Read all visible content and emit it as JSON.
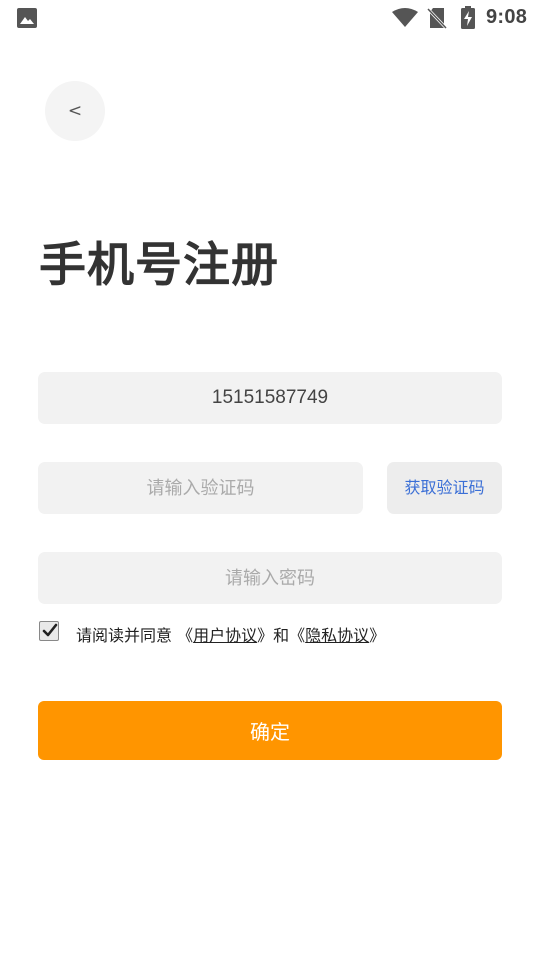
{
  "status_bar": {
    "time": "9:08",
    "icons": [
      "image-icon",
      "wifi-icon",
      "no-sim-icon",
      "battery-charging-icon"
    ]
  },
  "header": {
    "back_label": "<"
  },
  "title": "手机号注册",
  "form": {
    "phone_value": "15151587749",
    "code_placeholder": "请输入验证码",
    "get_code_label": "获取验证码",
    "password_placeholder": "请输入密码"
  },
  "agreement": {
    "checked": true,
    "prefix": "请阅读并同意 ",
    "open_bracket_1": "《",
    "user_agreement": "用户协议",
    "close_bracket_1": "》",
    "and": "和",
    "open_bracket_2": "《",
    "privacy_policy": "隐私协议",
    "close_bracket_2": "》"
  },
  "confirm_label": "确定",
  "colors": {
    "accent": "#ff9500",
    "link_blue": "#3b6fd6",
    "input_bg": "#f2f2f2"
  }
}
